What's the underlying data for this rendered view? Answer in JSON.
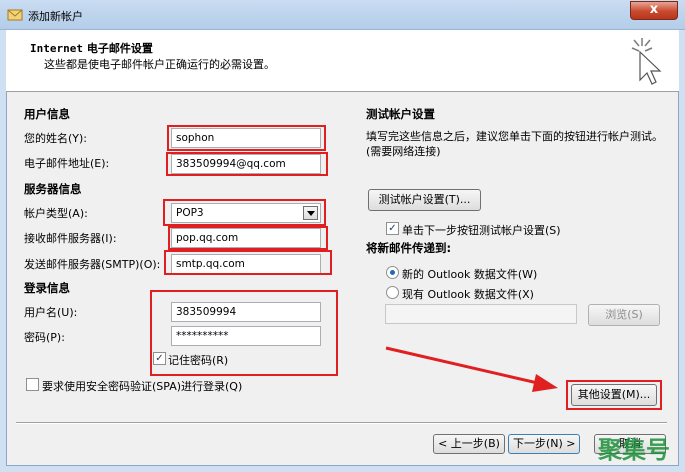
{
  "window": {
    "title": "添加新帐户",
    "close_symbol": "x"
  },
  "header": {
    "title_en": "Internet",
    "title_cn": " 电子邮件设置",
    "subtitle": "这些都是使电子邮件帐户正确运行的必需设置。"
  },
  "user_info": {
    "section": "用户信息",
    "name_label": "您的姓名(Y):",
    "name_value": "sophon",
    "email_label": "电子邮件地址(E):",
    "email_value": "383509994@qq.com"
  },
  "server_info": {
    "section": "服务器信息",
    "account_type_label": "帐户类型(A):",
    "account_type_value": "POP3",
    "incoming_label": "接收邮件服务器(I):",
    "incoming_value": "pop.qq.com",
    "outgoing_label": "发送邮件服务器(SMTP)(O):",
    "outgoing_value": "smtp.qq.com"
  },
  "login_info": {
    "section": "登录信息",
    "username_label": "用户名(U):",
    "username_value": "383509994",
    "password_label": "密码(P):",
    "password_value": "**********",
    "remember_label": "记住密码(R)",
    "remember_checked": "✓",
    "spa_label": "要求使用安全密码验证(SPA)进行登录(Q)"
  },
  "test_settings": {
    "section": "测试帐户设置",
    "description": "填写完这些信息之后，建议您单击下面的按钮进行帐户测试。(需要网络连接)",
    "test_button": "测试帐户设置(T)...",
    "auto_test_label": "单击下一步按钮测试帐户设置(S)",
    "auto_test_checked": "✓"
  },
  "deliver_to": {
    "section": "将新邮件传递到:",
    "new_file_label": "新的 Outlook 数据文件(W)",
    "existing_file_label": "现有 Outlook 数据文件(X)",
    "browse_button": "浏览(S)"
  },
  "buttons": {
    "more_settings": "其他设置(M)...",
    "back": "< 上一步(B)",
    "next": "下一步(N) >",
    "cancel": "取消"
  },
  "watermark": "聚集号",
  "colors": {
    "highlight_red": "#e02020",
    "arrow_red": "#e02020",
    "watermark_green": "#1d8f3a"
  }
}
